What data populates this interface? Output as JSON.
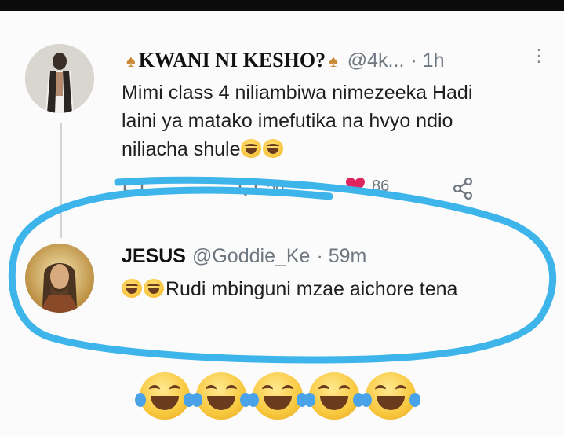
{
  "tweet1": {
    "display_name": "KWANI NI KESHO?",
    "handle": "@4k...",
    "time": "· 1h",
    "text_line1": "Mimi class 4 niliambiwa nimezeeka Hadi",
    "text_line2": "laini ya matako imefutika na hvyo ndio",
    "text_line3": "niliacha shule",
    "retweets": "50",
    "likes": "86",
    "menu_icon": "kebab-vertical"
  },
  "tweet2": {
    "display_name": "JESUS",
    "handle": "@Goddie_Ke",
    "time": "· 59m",
    "text": "Rudi mbinguni mzae aichore tena"
  },
  "decoration": {
    "circle_color": "#3db4ea",
    "bottom_emoji": "face-with-tears-of-joy",
    "bottom_emoji_count": 5
  }
}
